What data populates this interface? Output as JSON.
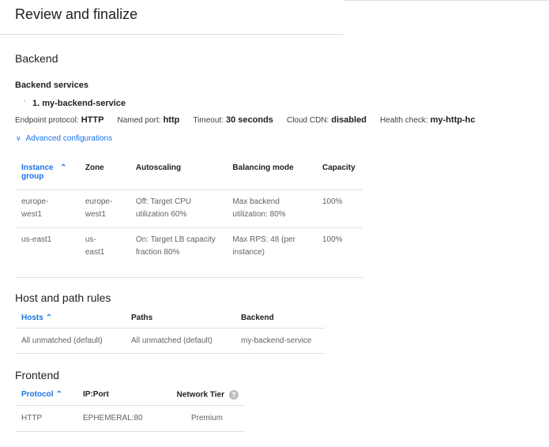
{
  "header": {
    "title": "Review and finalize"
  },
  "backend": {
    "section_title": "Backend",
    "services_title": "Backend services",
    "service_name": "1. my-backend-service",
    "props": {
      "endpoint_protocol_label": "Endpoint protocol:",
      "endpoint_protocol_value": "HTTP",
      "named_port_label": "Named port:",
      "named_port_value": "http",
      "timeout_label": "Timeout:",
      "timeout_value": "30 seconds",
      "cloud_cdn_label": "Cloud CDN:",
      "cloud_cdn_value": "disabled",
      "health_check_label": "Health check:",
      "health_check_value": "my-http-hc"
    },
    "advanced_link": "Advanced configurations",
    "table": {
      "headers": {
        "instance_group": "Instance group",
        "zone": "Zone",
        "autoscaling": "Autoscaling",
        "balancing_mode": "Balancing mode",
        "capacity": "Capacity"
      },
      "rows": [
        {
          "instance_group": "europe-west1",
          "zone": "europe-west1",
          "autoscaling": "Off: Target CPU utilization 60%",
          "balancing_mode": "Max backend utilization: 80%",
          "capacity": "100%"
        },
        {
          "instance_group": "us-east1",
          "zone": "us-east1",
          "autoscaling": "On: Target LB capacity fraction 80%",
          "balancing_mode": "Max RPS: 48 (per instance)",
          "capacity": "100%"
        }
      ]
    }
  },
  "host_rules": {
    "section_title": "Host and path rules",
    "headers": {
      "hosts": "Hosts",
      "paths": "Paths",
      "backend": "Backend"
    },
    "rows": [
      {
        "hosts": "All unmatched (default)",
        "paths": "All unmatched (default)",
        "backend": "my-backend-service"
      }
    ]
  },
  "frontend": {
    "section_title": "Frontend",
    "headers": {
      "protocol": "Protocol",
      "ip_port": "IP:Port",
      "network_tier": "Network Tier"
    },
    "rows": [
      {
        "protocol": "HTTP",
        "ip_port": "EPHEMERAL:80",
        "network_tier": "Premium"
      }
    ]
  },
  "icons": {
    "sort_ascending": "sort-ascending-icon",
    "expand": "chevron-down-icon",
    "help": "help-icon"
  },
  "colors": {
    "link": "#1a73e8",
    "border": "#e0e0e0",
    "text": "#202124",
    "muted": "#5f6368"
  }
}
